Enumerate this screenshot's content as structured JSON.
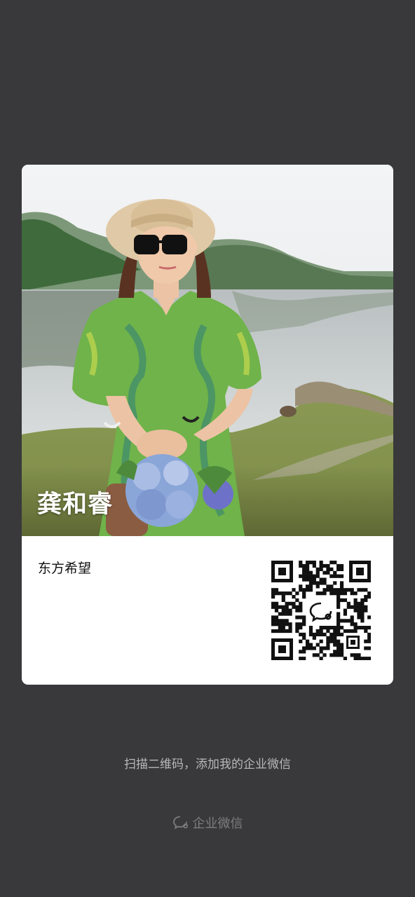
{
  "card": {
    "display_name": "龚和睿",
    "organization": "东方希望"
  },
  "footer": {
    "scan_tip": "扫描二维码，添加我的企业微信",
    "brand_label": "企业微信",
    "brand_icon": "wecom-chat-icon"
  },
  "colors": {
    "background": "#39393b",
    "card": "#ffffff",
    "tip_text": "#b8b8ba",
    "brand_text": "#7d7d80"
  }
}
